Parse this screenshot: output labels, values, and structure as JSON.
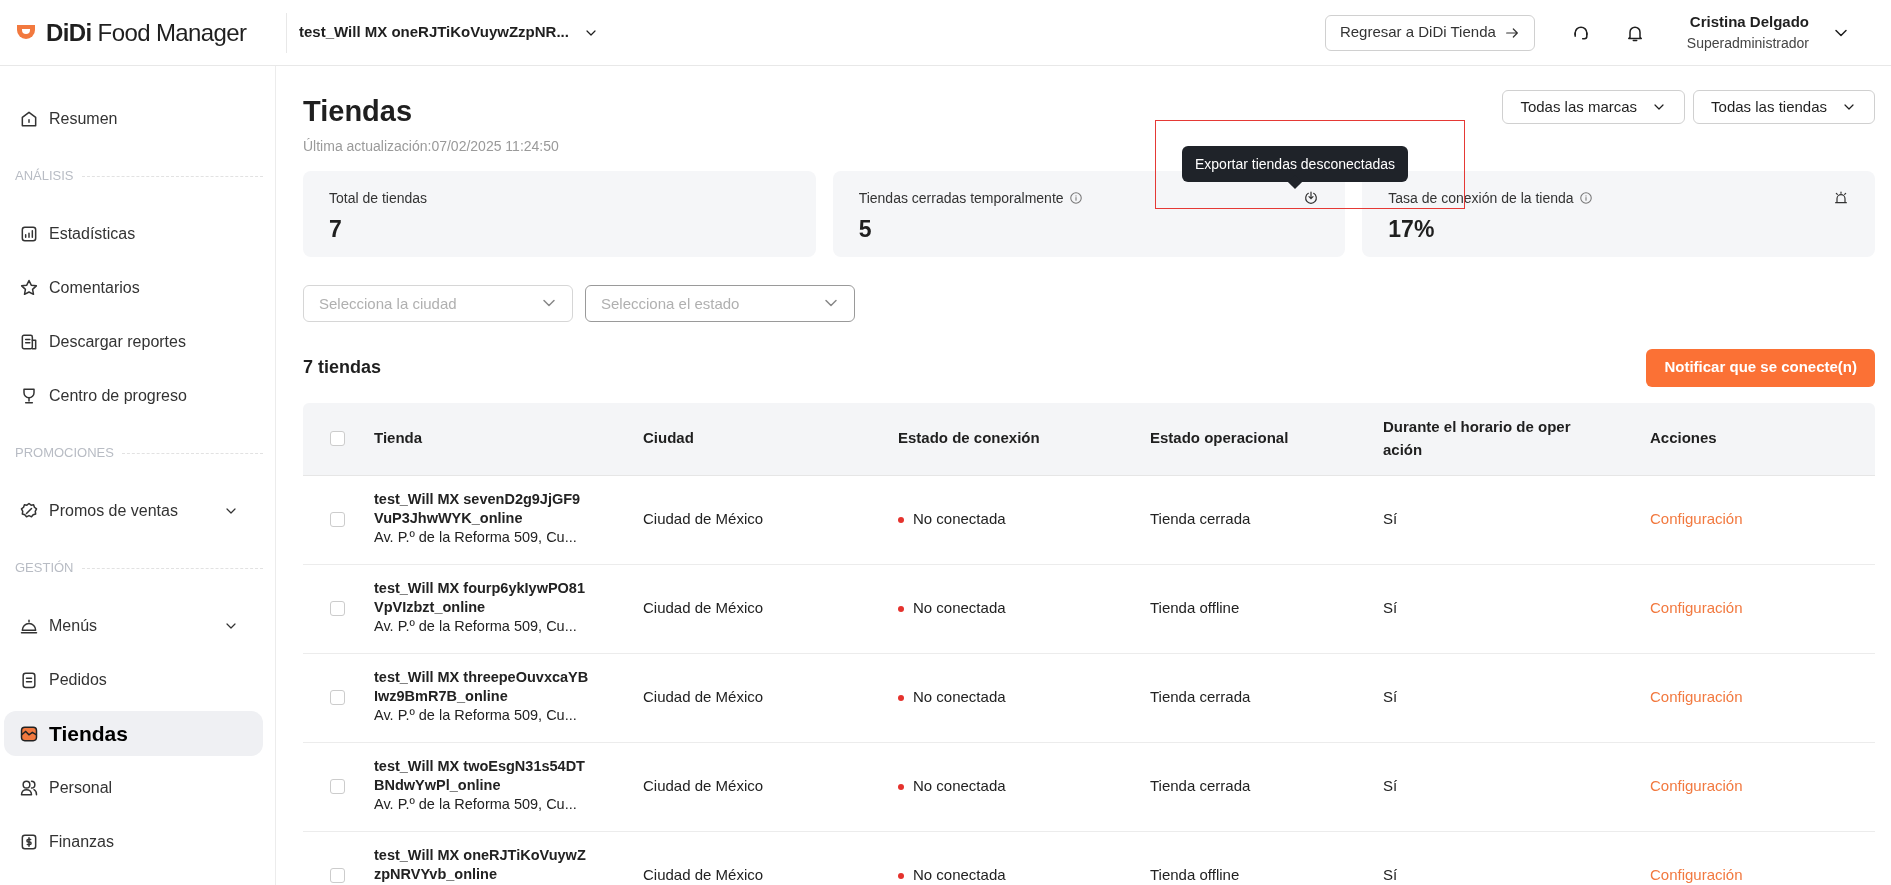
{
  "header": {
    "brand_bold": "DiDi",
    "brand_light": "Food Manager",
    "store_selector": "test_Will MX oneRJTiKoVuywZzpNR...",
    "back_button": "Regresar a DiDi Tienda",
    "user_name": "Cristina Delgado",
    "user_role": "Superadministrador"
  },
  "sidebar": {
    "items": [
      {
        "kind": "item",
        "label": "Resumen",
        "selected": false,
        "expandable": false
      },
      {
        "kind": "section",
        "label": "ANÁLISIS"
      },
      {
        "kind": "item",
        "label": "Estadísticas",
        "selected": false,
        "expandable": false
      },
      {
        "kind": "item",
        "label": "Comentarios",
        "selected": false,
        "expandable": false
      },
      {
        "kind": "item",
        "label": "Descargar reportes",
        "selected": false,
        "expandable": false
      },
      {
        "kind": "item",
        "label": "Centro de progreso",
        "selected": false,
        "expandable": false
      },
      {
        "kind": "section",
        "label": "PROMOCIONES"
      },
      {
        "kind": "item",
        "label": "Promos de ventas",
        "selected": false,
        "expandable": true
      },
      {
        "kind": "section",
        "label": "GESTIÓN"
      },
      {
        "kind": "item",
        "label": "Menús",
        "selected": false,
        "expandable": true
      },
      {
        "kind": "item",
        "label": "Pedidos",
        "selected": false,
        "expandable": false
      },
      {
        "kind": "item",
        "label": "Tiendas",
        "selected": true,
        "expandable": false
      },
      {
        "kind": "item",
        "label": "Personal",
        "selected": false,
        "expandable": false
      },
      {
        "kind": "item",
        "label": "Finanzas",
        "selected": false,
        "expandable": false
      }
    ]
  },
  "page": {
    "title": "Tiendas",
    "updated": "Última actualización:07/02/2025 11:24:50",
    "brand_filter": "Todas las marcas",
    "store_filter": "Todas las tiendas"
  },
  "stats": [
    {
      "label": "Total de tiendas",
      "value": "7",
      "info": false
    },
    {
      "label": "Tiendas cerradas temporalmente",
      "value": "5",
      "info": true
    },
    {
      "label": "Tasa de conexión de la tienda",
      "value": "17%",
      "info": true
    }
  ],
  "tooltip": "Exportar tiendas desconectadas",
  "filters": [
    {
      "placeholder": "Selecciona la ciudad"
    },
    {
      "placeholder": "Selecciona el estado"
    }
  ],
  "count": "7 tiendas",
  "notify_button": "Notificar que se conecte(n)",
  "table": {
    "all_checked": false,
    "columns": [
      "Tienda",
      "Ciudad",
      "Estado de conexión",
      "Estado operacional",
      "Durante el horario de operación",
      "Acciones"
    ],
    "rows": [
      {
        "checked": false,
        "name": "test_Will MX sevenD2g9JjGF9 VuP3JhwWYK_online",
        "address": "Av. P.º de la Reforma 509, Cu...",
        "city": "Ciudad de México",
        "connection": "No conectada",
        "operational": "Tienda cerrada",
        "during_hours": "Sí",
        "action": "Configuración"
      },
      {
        "checked": false,
        "name": "test_Will MX fourp6ykIywPO81 VpVIzbzt_online",
        "address": "Av. P.º de la Reforma 509, Cu...",
        "city": "Ciudad de México",
        "connection": "No conectada",
        "operational": "Tienda offline",
        "during_hours": "Sí",
        "action": "Configuración"
      },
      {
        "checked": false,
        "name": "test_Will MX threepeOuvxcaYB Iwz9BmR7B_online",
        "address": "Av. P.º de la Reforma 509, Cu...",
        "city": "Ciudad de México",
        "connection": "No conectada",
        "operational": "Tienda cerrada",
        "during_hours": "Sí",
        "action": "Configuración"
      },
      {
        "checked": false,
        "name": "test_Will MX twoEsgN31s54DT BNdwYwPl_online",
        "address": "Av. P.º de la Reforma 509, Cu...",
        "city": "Ciudad de México",
        "connection": "No conectada",
        "operational": "Tienda cerrada",
        "during_hours": "Sí",
        "action": "Configuración"
      },
      {
        "checked": false,
        "name": "test_Will MX oneRJTiKoVuywZ zpNRVYvb_online",
        "city": "Ciudad de México",
        "connection": "No conectada",
        "operational": "Tienda offline",
        "during_hours": "Sí",
        "action": "Configuración"
      }
    ]
  }
}
